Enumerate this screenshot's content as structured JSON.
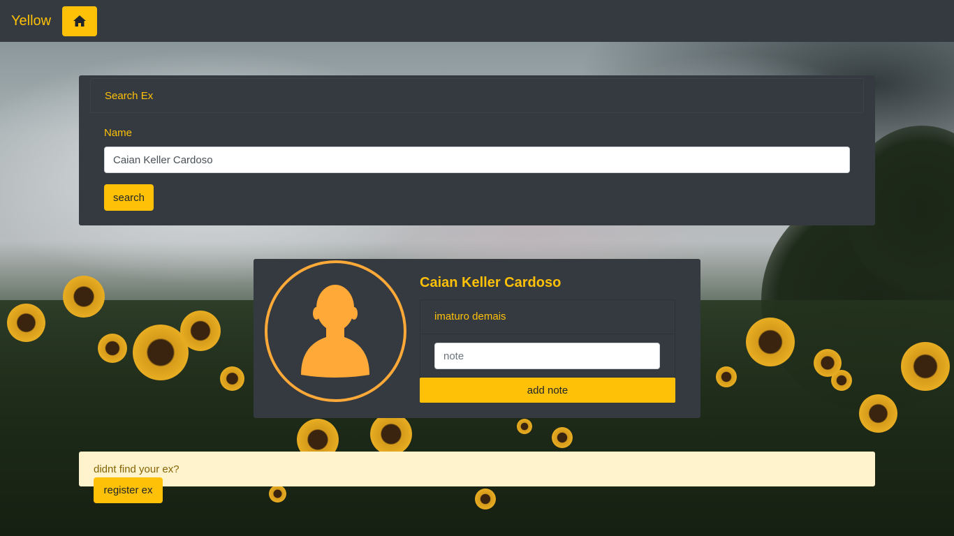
{
  "navbar": {
    "brand": "Yellow",
    "home_icon": "home-icon"
  },
  "search": {
    "header": "Search Ex",
    "name_label": "Name",
    "name_value": "Caian Keller Cardoso",
    "button_label": "search"
  },
  "profile": {
    "avatar_icon": "user-silhouette-icon",
    "name": "Caian Keller Cardoso",
    "note": "imaturo demais",
    "note_placeholder": "note",
    "add_note_label": "add note"
  },
  "alert": {
    "text": "didnt find your ex?",
    "register_label": "register ex"
  },
  "colors": {
    "accent": "#ffc107",
    "dark": "#343a40",
    "avatar": "#ffa938",
    "alert_bg": "#fff3cd"
  }
}
